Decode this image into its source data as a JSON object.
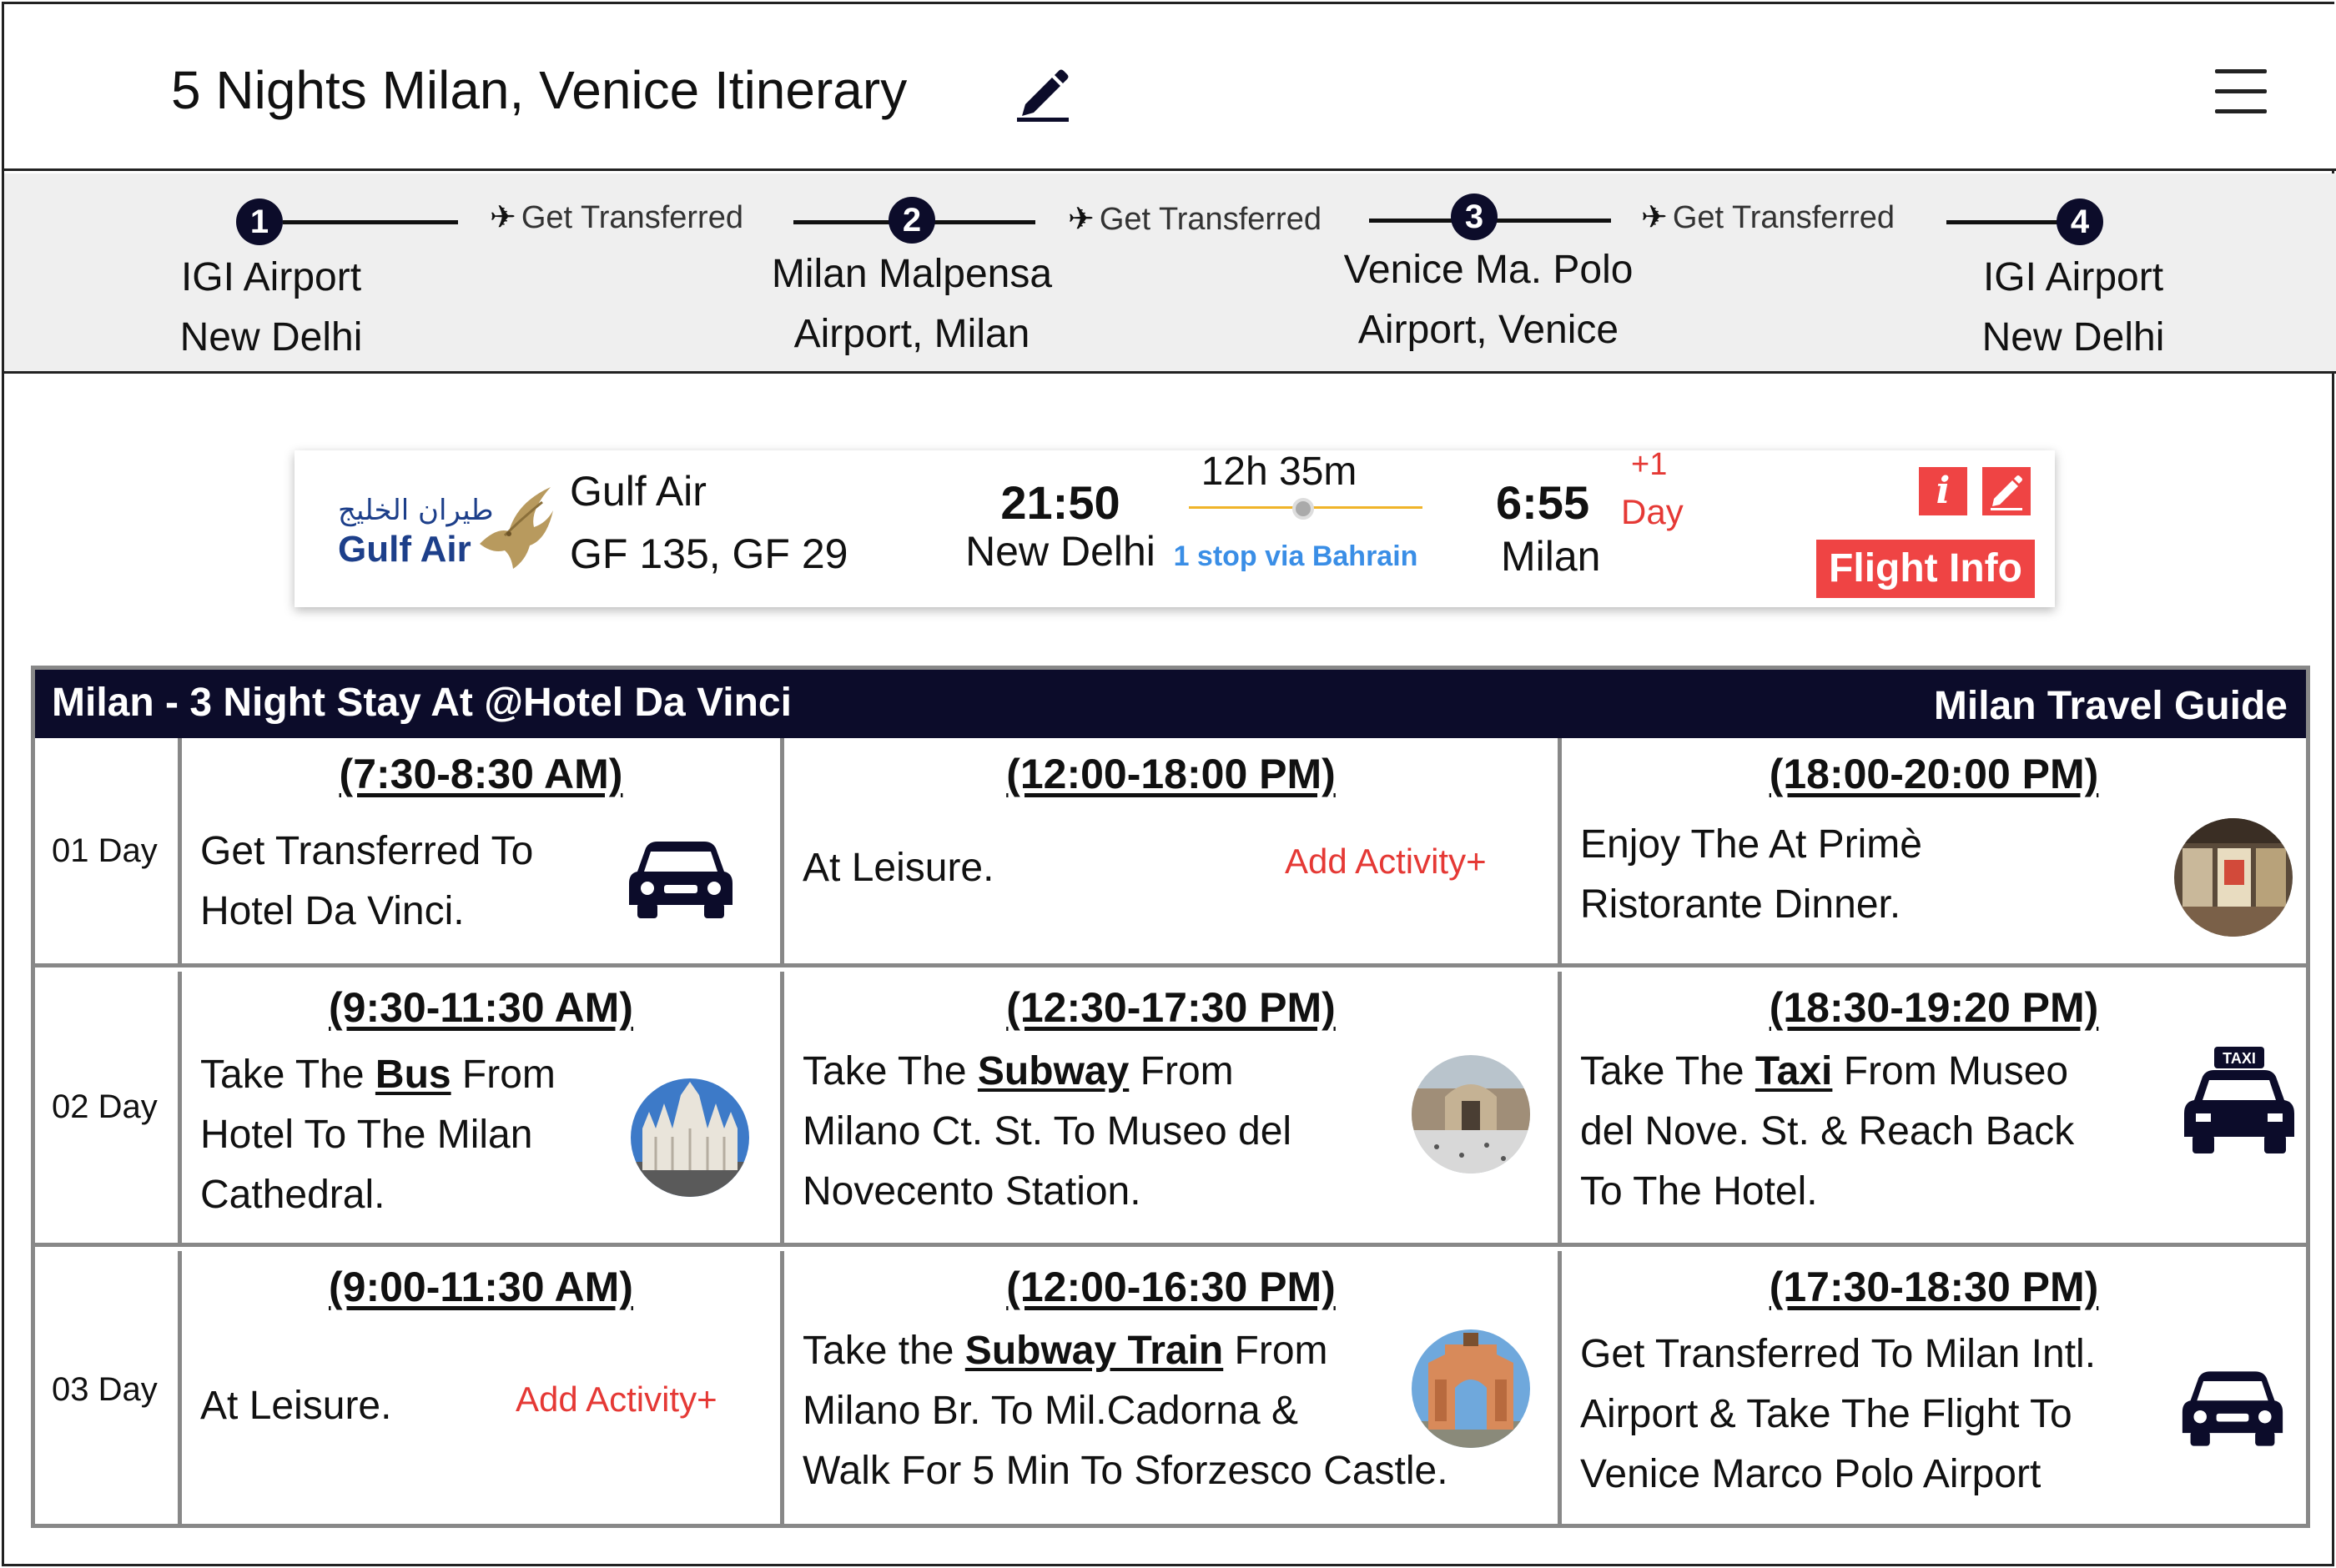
{
  "header": {
    "title": "5 Nights Milan, Venice Itinerary"
  },
  "route": {
    "stops": [
      {
        "num": "1",
        "line1": "IGI Airport",
        "line2": "New Delhi"
      },
      {
        "num": "2",
        "line1": "Milan Malpensa",
        "line2": "Airport, Milan"
      },
      {
        "num": "3",
        "line1": "Venice Ma. Polo",
        "line2": "Airport, Venice"
      },
      {
        "num": "4",
        "line1": "IGI Airport",
        "line2": "New Delhi"
      }
    ],
    "transfers": [
      "Get Transferred",
      "Get Transferred",
      "Get Transferred"
    ]
  },
  "flight": {
    "logo_arabic": "طيران الخليج",
    "logo_english": "Gulf Air",
    "airline": "Gulf Air",
    "flight_numbers": "GF 135, GF 29",
    "departure_time": "21:50",
    "departure_city": "New Delhi",
    "duration": "12h 35m",
    "stops": "1 stop via Bahrain",
    "arrival_time": "6:55",
    "arrival_plus": "+1",
    "arrival_plus_label": "Day",
    "arrival_city": "Milan",
    "info_label": "Flight Info",
    "info_icon": "i"
  },
  "itinerary": {
    "heading": "Milan - 3 Night Stay At @Hotel Da Vinci",
    "guide_link": "Milan Travel Guide",
    "add_activity": "Add Activity+",
    "days": [
      {
        "label": "01 Day",
        "slots": [
          {
            "time": "(7:30-8:30 AM)",
            "line1": "Get Transferred To",
            "line2": "Hotel Da Vinci.",
            "icon": "car-icon"
          },
          {
            "time": "(12:00-18:00 PM)",
            "line1": "At Leisure."
          },
          {
            "time": "(18:00-20:00 PM)",
            "line1": "Enjoy The At Primè",
            "line2": "Ristorante Dinner.",
            "icon": "restaurant-photo"
          }
        ]
      },
      {
        "label": "02 Day",
        "slots": [
          {
            "time": "(9:30-11:30 AM)",
            "pre": "Take The ",
            "bold": "Bus",
            "post": " From",
            "line2": "Hotel To The Milan",
            "line3": "Cathedral.",
            "icon": "cathedral-photo"
          },
          {
            "time": "(12:30-17:30 PM)",
            "pre": "Take The ",
            "bold": "Subway",
            "post": " From",
            "line2": "Milano Ct. St. To Museo del",
            "line3": "Novecento Station.",
            "icon": "museum-photo"
          },
          {
            "time": "(18:30-19:20 PM)",
            "pre": "Take The ",
            "bold": "Taxi",
            "post": " From Museo",
            "line2": "del Nove. St. & Reach Back",
            "line3": "To The Hotel.",
            "icon": "taxi-icon",
            "taxi_sign": "TAXI"
          }
        ]
      },
      {
        "label": "03 Day",
        "slots": [
          {
            "time": "(9:00-11:30 AM)",
            "line1": "At Leisure."
          },
          {
            "time": "(12:00-16:30 PM)",
            "pre": "Take the ",
            "bold": "Subway Train",
            "post": " From",
            "line2": "Milano Br. To Mil.Cadorna &",
            "line3": "Walk For 5 Min To Sforzesco Castle.",
            "icon": "arch-photo"
          },
          {
            "time": "(17:30-18:30 PM)",
            "line1": "Get Transferred To Milan Intl.",
            "line2": "Airport & Take The Flight To",
            "line3": "Venice Marco Polo Airport",
            "icon": "car-icon"
          }
        ]
      }
    ]
  },
  "colors": {
    "navy": "#0c0c2a",
    "red": "#ef4444",
    "blue_link": "#3a8ee6",
    "route_bg": "#efefef"
  }
}
